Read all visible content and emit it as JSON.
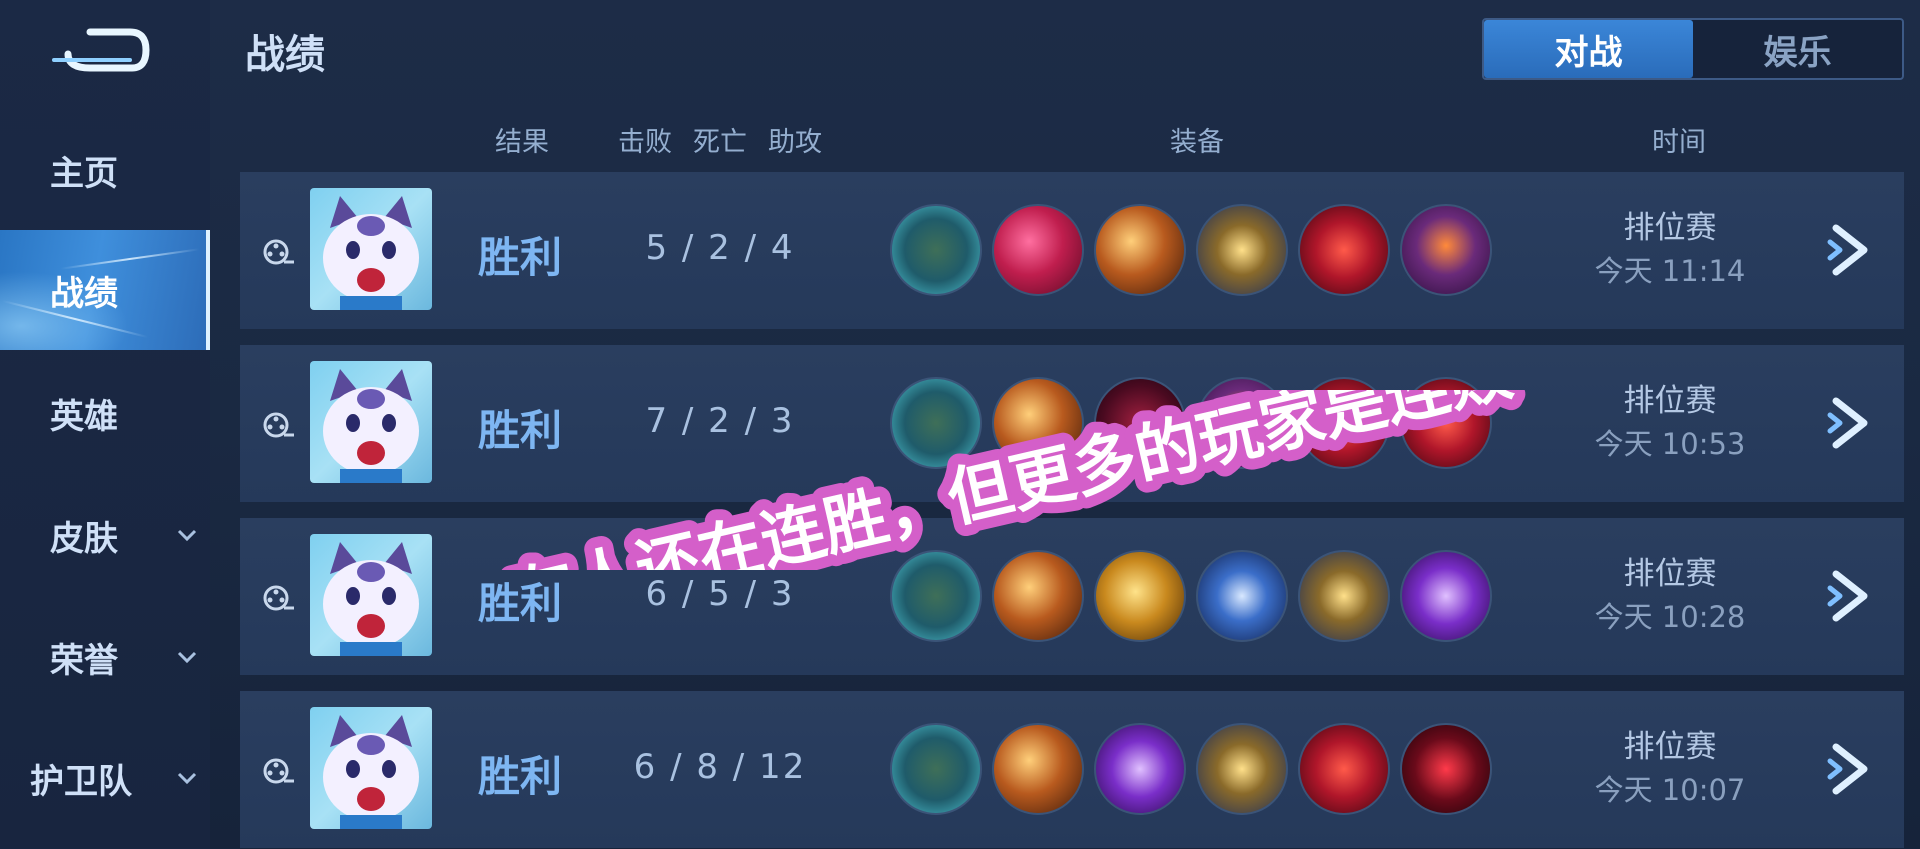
{
  "sidebar": {
    "items": [
      {
        "label": "主页"
      },
      {
        "label": "战绩"
      },
      {
        "label": "英雄"
      },
      {
        "label": "皮肤"
      },
      {
        "label": "荣誉"
      },
      {
        "label": "护卫队"
      }
    ]
  },
  "page": {
    "title": "战绩"
  },
  "tabs": [
    {
      "label": "对战"
    },
    {
      "label": "娱乐"
    }
  ],
  "columns": {
    "result": "结果",
    "kills": "击败",
    "deaths": "死亡",
    "assists": "助攻",
    "equipment": "装备",
    "time": "时间"
  },
  "matches": [
    {
      "result": "胜利",
      "kda": "5 / 2 / 4",
      "mode": "排位赛",
      "time": "今天 11:14",
      "items": [
        "teal-boot-icon",
        "crimson-blade-icon",
        "amber-dagger-icon",
        "golden-star-icon",
        "red-wing-icon",
        "purple-armor-icon"
      ]
    },
    {
      "result": "胜利",
      "kda": "7 / 2 / 3",
      "mode": "排位赛",
      "time": "今天 10:53",
      "items": [
        "teal-boot-icon",
        "amber-dagger-icon",
        "dark-crimson-icon",
        "purple-armor-icon",
        "red-wing-icon",
        "red-wing-icon"
      ]
    },
    {
      "result": "胜利",
      "kda": "6 / 5 / 3",
      "mode": "排位赛",
      "time": "今天 10:28",
      "items": [
        "teal-boot-icon",
        "amber-dagger-icon",
        "golden-spear-icon",
        "blue-sword-icon",
        "golden-star-icon",
        "purple-axe-icon"
      ]
    },
    {
      "result": "胜利",
      "kda": "6 / 8 / 12",
      "mode": "排位赛",
      "time": "今天 10:07",
      "items": [
        "teal-boot-icon",
        "amber-dagger-icon",
        "purple-axe-icon",
        "golden-star-icon",
        "red-wing-icon",
        "crimson-cape-icon"
      ]
    }
  ],
  "overlay": {
    "caption": "有人还在连胜，但更多的玩家是连败"
  },
  "colors": {
    "accent": "#3b86d8",
    "win": "#7eb6f2",
    "caption_fill": "#d45fc9"
  }
}
